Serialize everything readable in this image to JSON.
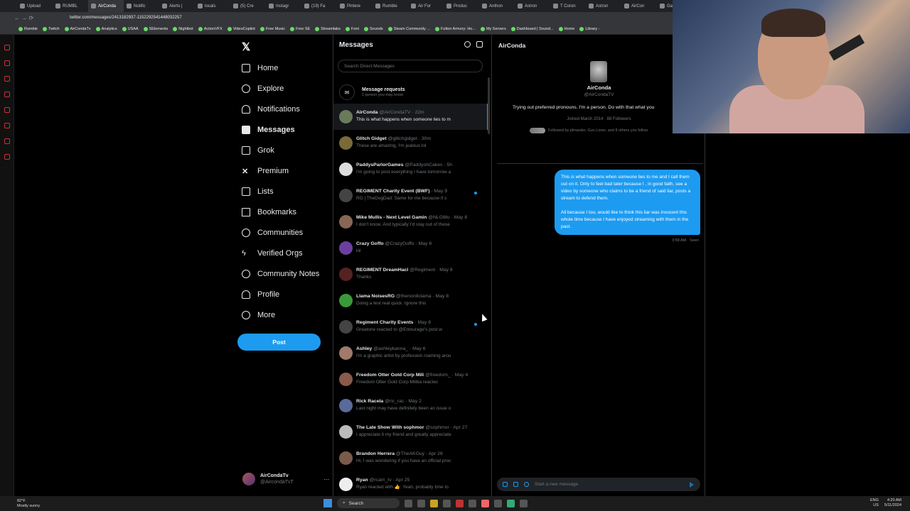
{
  "browser": {
    "tabs": [
      "Upload",
      "RUMBL",
      "AirConda",
      "Notific",
      "Alerts |",
      "locals",
      "(5) Cre",
      "Instagr",
      "(19) Fa",
      "Pintere",
      "Rumble",
      "Air For",
      "Produc",
      "Anthon",
      "Astron",
      "T Coron",
      "Astron",
      "AirCon",
      "Gay"
    ],
    "url": "twitter.com/messages/2413182937-1152292541448032257",
    "bookmarks": [
      "Rumble",
      "Twitch",
      "AirCondaTv",
      "Analytics",
      "USAA",
      "SElements",
      "Nightbot",
      "ActionVFX",
      "VideoCopilot",
      "Free Music",
      "Free SE",
      "Streamlabs",
      "Font",
      "Sounds",
      "Steam Community ...",
      "Fulton Armory: Ho...",
      "My Servers",
      "Dashboard | Sound...",
      "Home",
      "Library -"
    ]
  },
  "nav": {
    "items": [
      "Home",
      "Explore",
      "Notifications",
      "Messages",
      "Grok",
      "Premium",
      "Lists",
      "Bookmarks",
      "Communities",
      "Verified Orgs",
      "Community Notes",
      "Profile",
      "More"
    ],
    "post_label": "Post",
    "profile_name": "AirCondaTv",
    "profile_handle": "@AircondaTvT"
  },
  "messages": {
    "title": "Messages",
    "search_placeholder": "Search Direct Messages",
    "requests_title": "Message requests",
    "requests_sub": "1 person you may know",
    "conversations": [
      {
        "name": "AirConda",
        "meta": "@AirCondaTV · 22m",
        "preview": "This is what happens when someone lies to m"
      },
      {
        "name": "Glitch Gidget",
        "meta": "@glitchgidget · 30m",
        "preview": "These are amazing, I'm jealous lol"
      },
      {
        "name": "PaddysParlorGames",
        "meta": "@PaddyohCakes · 5h",
        "preview": "I'm going to post everything I have tomorrow a"
      },
      {
        "name": "REGIMENT Charity Event (BWF)",
        "meta": "· May 9",
        "preview": "RG | TheDogDad: Same for me because if s"
      },
      {
        "name": "Mike Mullis - Next Level Gamin",
        "meta": "@NLGMu · May 8",
        "preview": "I don't know. And typically I'd stay out of these"
      },
      {
        "name": "Crazy Goffo",
        "meta": "@CrazyGoffo · May 8",
        "preview": "lol"
      },
      {
        "name": "REGIMENT DreamHacl",
        "meta": "@Regiment · May 8",
        "preview": "Thanks"
      },
      {
        "name": "Llama NoisesRG",
        "meta": "@thenordiclama · May 8",
        "preview": "Doing a test real quick. Ignore this"
      },
      {
        "name": "Regiment Charity Events",
        "meta": "· May 8",
        "preview": "Greatone reacted to @Entxurage's post w"
      },
      {
        "name": "Ashley",
        "meta": "@ashleykanna_ · May 6",
        "preview": "I'm a graphic artist by profession roaming arou"
      },
      {
        "name": "Freedom Otter Gold Corp Mili",
        "meta": "@freedom_ · May 4",
        "preview": "Freedom Otter Gold Corp Militia reactec"
      },
      {
        "name": "Rick Racela",
        "meta": "@ric_rac · May 2",
        "preview": "Last night may have definitely been an issue o"
      },
      {
        "name": "The Late Show With sophmor",
        "meta": "@sophmor · Apr 27",
        "preview": "I appreciate it my friend and greatly appreciate"
      },
      {
        "name": "Brandon Herrera",
        "meta": "@TheAKGuy · Apr 26",
        "preview": "Hi, I was wondering if you have an official proc"
      },
      {
        "name": "Ryan",
        "meta": "@rcam_tv · Apr 25",
        "preview": "Ryan reacted with 👍: Yeah, probably time to"
      }
    ]
  },
  "chat": {
    "title": "AirConda",
    "name": "AirConda",
    "handle": "@AirCondaTV",
    "bio": "Trying out preferred pronouns. I'm a person. Do with that what you",
    "joined": "Joined March 2014 · 88 Followers",
    "followed_by": "Followed by jdmarder, Gun Lover, and 8 others you follow",
    "message_p1": "This is what happens when someone lies to me and I call them out on it. Only to feel bad later because I , in good faith, see a video by someone who claims to be a friend of said liar, posts a stream to defend them.",
    "message_p2": "All because I too, would like to think this liar was innocent this whole time because I have enjoyed streaming with them in the past.",
    "message_meta": "3:58 AM · Seen",
    "composer_placeholder": "Start a new message"
  },
  "taskbar": {
    "weather_temp": "82°F",
    "weather_desc": "Mostly sunny",
    "search_label": "Search",
    "lang": "ENG",
    "region": "US",
    "time": "4:20 AM",
    "date": "5/11/2024"
  },
  "colors": {
    "accent": "#1d9bf0",
    "background": "#000000",
    "border": "#2f3336"
  }
}
